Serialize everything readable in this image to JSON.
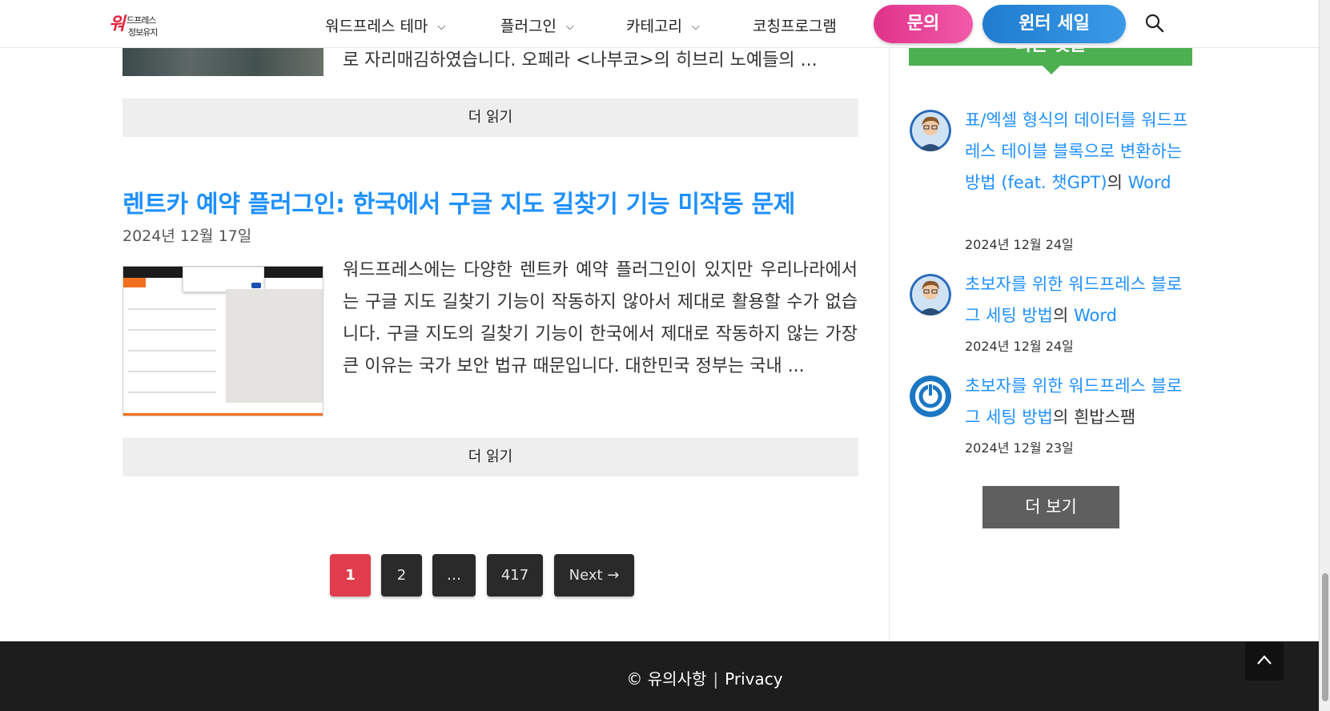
{
  "header": {
    "logo": {
      "line1": "워",
      "line2": "드프레스",
      "line3": "정보유지"
    },
    "nav": [
      {
        "label": "워드프레스 테마",
        "has_dropdown": true
      },
      {
        "label": "플러그인",
        "has_dropdown": true
      },
      {
        "label": "카테고리",
        "has_dropdown": true
      },
      {
        "label": "코칭프로그램",
        "has_dropdown": false
      }
    ],
    "contact_label": "문의",
    "sale_label": "윈터 세일"
  },
  "main": {
    "prev_excerpt": "로 자리매김하였습니다. 오페라 <나부코>의 히브리 노예들의 ...",
    "read_more_label": "더 읽기",
    "post": {
      "title": "렌트카 예약 플러그인: 한국에서 구글 지도 길찾기 기능 미작동 문제",
      "date": "2024년 12월 17일",
      "excerpt": "워드프레스에는 다양한 렌트카 예약 플러그인이 있지만 우리나라에서는 구글 지도 길찾기 기능이 작동하지 않아서 제대로 활용할 수가 없습니다. 구글 지도의 길찾기 기능이 한국에서 제대로 작동하지 않는 가장 큰 이유는 국가 보안 법규 때문입니다. 대한민국 정부는 국내 ..."
    },
    "pagination": [
      "1",
      "2",
      "…",
      "417",
      "Next →"
    ]
  },
  "sidebar": {
    "widget_title": "최근 댓글",
    "comments": [
      {
        "link": "표/엑셀 형식의 데이터를 워드프레스 테이블 블록으로 변환하는 방법 (feat. 챗GPT)",
        "connector": "의",
        "author": "Word",
        "author_is_link": true,
        "date": "2024년 12월 24일"
      },
      {
        "link": "초보자를 위한 워드프레스 블로그 세팅 방법",
        "connector": "의",
        "author": "Word",
        "author_is_link": true,
        "date": "2024년 12월 24일"
      },
      {
        "link": "초보자를 위한 워드프레스 블로그 세팅 방법",
        "connector": "의",
        "author": "흰밥스팸",
        "author_is_link": false,
        "date": "2024년 12월 23일"
      }
    ],
    "more_label": "더 보기"
  },
  "footer": {
    "notice": "© 유의사항",
    "separator": "|",
    "privacy": "Privacy"
  },
  "colors": {
    "accent_blue": "#1e90ff",
    "active_page": "#e23d4e",
    "widget_green": "#4caf50",
    "contact_pink": "#e0338a",
    "sale_blue": "#1f7ccf"
  }
}
